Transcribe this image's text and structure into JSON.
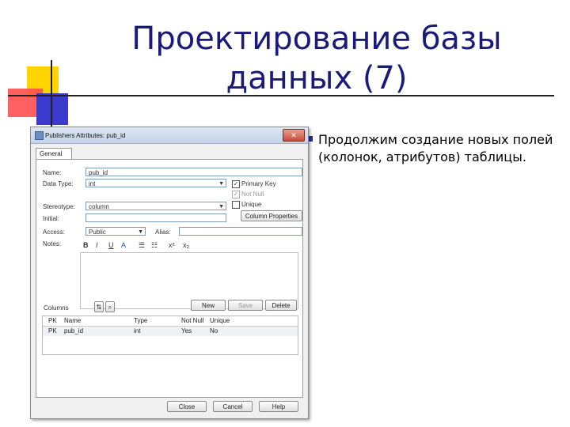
{
  "slide": {
    "title_line1": "Проектирование базы",
    "title_line2": "данных (7)",
    "bullet": "Продолжим создание новых полей (колонок, атрибутов) таблицы."
  },
  "colors": {
    "title": "#1a1a7a",
    "bullet": "#2d2d8f",
    "deco_yellow": "#ffd400",
    "deco_red": "#ff5050",
    "deco_blue": "#3a3acc"
  },
  "dialog": {
    "title": "Publishers Attributes: pub_id",
    "close_symbol": "✕",
    "tab_general": "General",
    "name_label": "Name:",
    "name_value": "pub_id",
    "datatype_label": "Data Type:",
    "datatype_value": "int",
    "stereotype_label": "Stereotype:",
    "stereotype_value": "column",
    "initial_label": "Initial:",
    "access_label": "Access:",
    "access_value": "Public",
    "alias_label": "Alias:",
    "notes_label": "Notes:",
    "primary_key_label": "Primary Key",
    "primary_key_checked": true,
    "not_null_label": "Not Null",
    "not_null_checked": true,
    "unique_label": "Unique",
    "unique_checked": false,
    "column_properties_button": "Column Properties",
    "notes_toolbar": [
      "B",
      "I",
      "U",
      "A",
      "☰",
      "☷",
      "x²",
      "x₂"
    ],
    "columns_label": "Columns",
    "new_button": "New",
    "save_button": "Save",
    "delete_button": "Delete",
    "table": {
      "headers": [
        "PK",
        "Name",
        "Type",
        "Not Null",
        "Unique"
      ],
      "rows": [
        [
          "PK",
          "pub_id",
          "int",
          "Yes",
          "No"
        ]
      ]
    },
    "close_button": "Close",
    "cancel_button": "Cancel",
    "help_button": "Help"
  }
}
